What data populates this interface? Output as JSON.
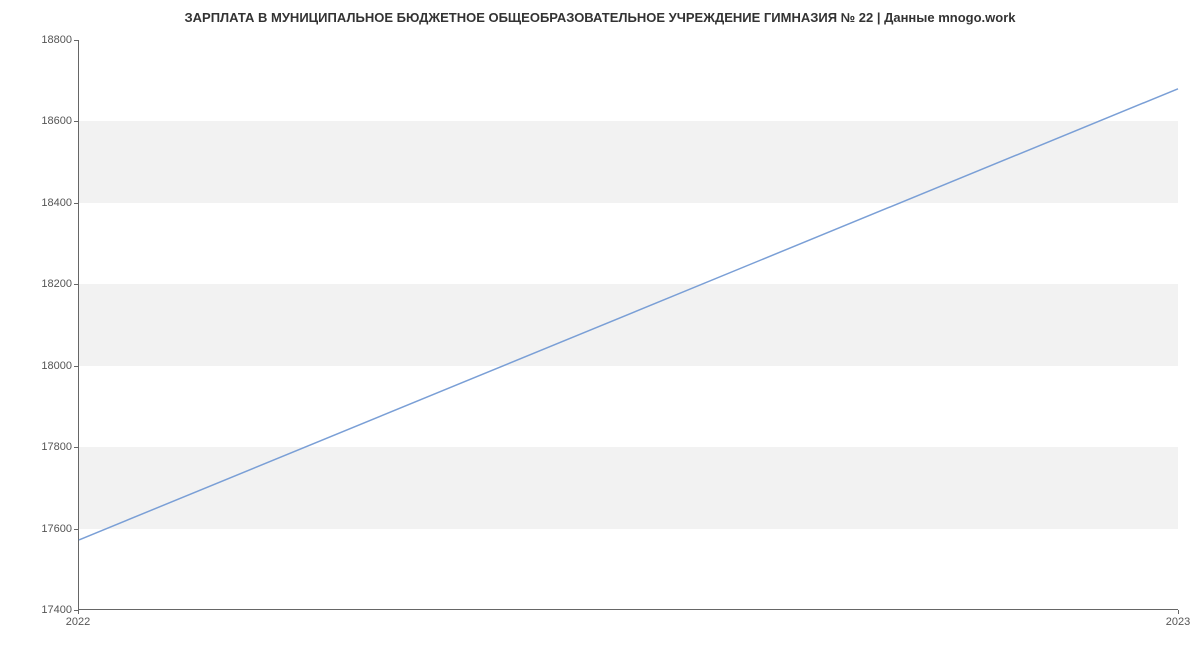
{
  "chart_data": {
    "type": "line",
    "title": "ЗАРПЛАТА В МУНИЦИПАЛЬНОЕ БЮДЖЕТНОЕ ОБЩЕОБРАЗОВАТЕЛЬНОЕ УЧРЕЖДЕНИЕ ГИМНАЗИЯ № 22 | Данные mnogo.work",
    "x": [
      "2022",
      "2023"
    ],
    "values": [
      17570,
      18680
    ],
    "xlabel": "",
    "ylabel": "",
    "ylim": [
      17400,
      18800
    ],
    "y_ticks": [
      17400,
      17600,
      17800,
      18000,
      18200,
      18400,
      18600,
      18800
    ],
    "x_ticks": [
      "2022",
      "2023"
    ],
    "line_color": "#7a9fd6",
    "grid_band_color": "#f2f2f2"
  }
}
